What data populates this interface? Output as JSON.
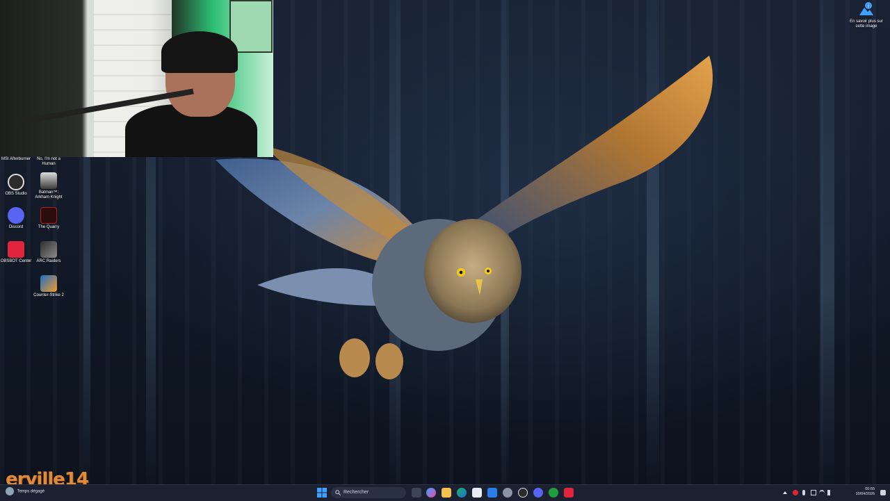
{
  "desktop": {
    "icons": [
      {
        "label": "MSI Afterburner",
        "icon": "msi-afterburner-icon"
      },
      {
        "label": "No, I'm not a Human",
        "icon": "game-icon"
      },
      {
        "label": "OBS Studio",
        "icon": "obs-icon"
      },
      {
        "label": "Batman™: Arkham Knight",
        "icon": "batman-icon"
      },
      {
        "label": "Discord",
        "icon": "discord-icon"
      },
      {
        "label": "The Quarry",
        "icon": "the-quarry-icon"
      },
      {
        "label": "OBSBOT Center",
        "icon": "obsbot-icon"
      },
      {
        "label": "ARC Raiders",
        "icon": "arc-raiders-icon"
      },
      {
        "label": "Counter-Strike 2",
        "icon": "counter-strike-icon"
      }
    ],
    "learn_more": {
      "label": "En savoir plus sur cette image",
      "icon": "info-icon"
    },
    "watermark": "erville14"
  },
  "taskbar": {
    "weather_text": "Temps dégagé",
    "search_placeholder": "Rechercher",
    "clock_time": "00:55",
    "clock_date": "10/04/2026",
    "apps": [
      "task-view-icon",
      "copilot-icon",
      "file-explorer-icon",
      "edge-icon",
      "store-icon",
      "mail-icon",
      "settings-icon",
      "obs-icon",
      "discord-icon",
      "xbox-icon",
      "obsbot-icon"
    ]
  },
  "colors": {
    "taskbar_bg": "#1b2130",
    "accent_watermark": "#e08a3a",
    "discord": "#5865f2",
    "obsbot": "#e0243b",
    "xbox": "#1f9e3f",
    "windows_blue": "#3fa0ff"
  }
}
